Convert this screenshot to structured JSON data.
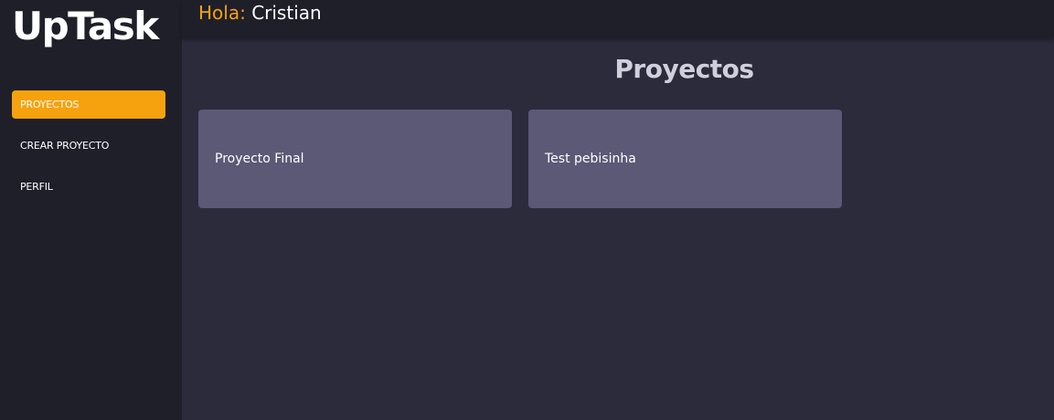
{
  "app": {
    "logo": "UpTask"
  },
  "sidebar": {
    "items": [
      {
        "label": "PROYECTOS",
        "active": true
      },
      {
        "label": "CREAR PROYECTO",
        "active": false
      },
      {
        "label": "PERFIL",
        "active": false
      }
    ]
  },
  "header": {
    "greeting_prefix": "Hola:",
    "user_name": "Cristian"
  },
  "main": {
    "title": "Proyectos",
    "projects": [
      {
        "name": "Proyecto Final"
      },
      {
        "name": "Test pebisinha"
      }
    ]
  },
  "colors": {
    "accent": "#f6a20e",
    "sidebar_bg": "#1f1f2a",
    "main_bg": "#2c2b3c",
    "card_bg": "#5b5976"
  }
}
